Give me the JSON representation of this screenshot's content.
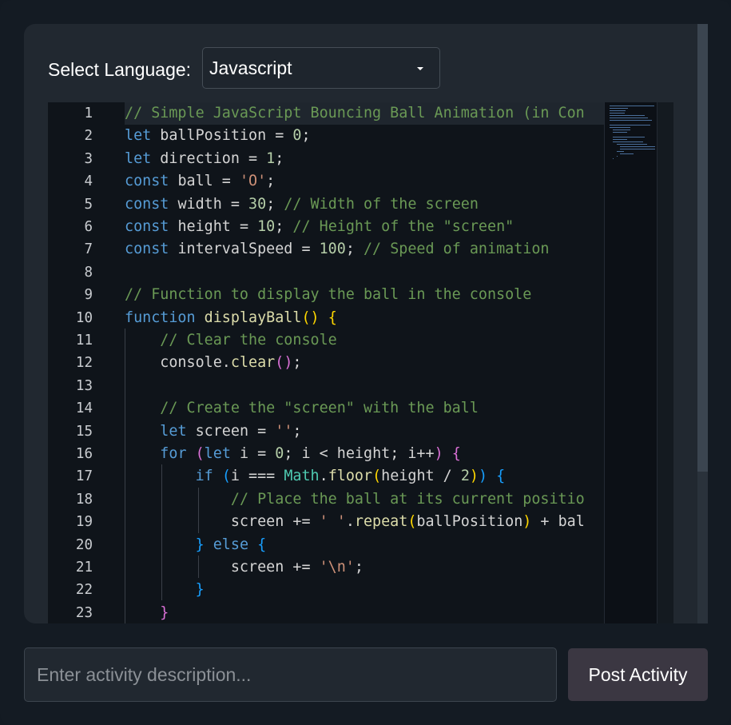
{
  "language": {
    "label": "Select Language:",
    "selected": "Javascript"
  },
  "editor": {
    "line_numbers": [
      "1",
      "2",
      "3",
      "4",
      "5",
      "6",
      "7",
      "8",
      "9",
      "10",
      "11",
      "12",
      "13",
      "14",
      "15",
      "16",
      "17",
      "18",
      "19",
      "20",
      "21",
      "22",
      "23"
    ],
    "current_line": 1,
    "lines": [
      [
        [
          "c",
          "// Simple JavaScript Bouncing Ball Animation (in Con"
        ]
      ],
      [
        [
          "k",
          "let"
        ],
        [
          "v",
          " ballPosition = "
        ],
        [
          "n",
          "0"
        ],
        [
          "v",
          ";"
        ]
      ],
      [
        [
          "k",
          "let"
        ],
        [
          "v",
          " direction = "
        ],
        [
          "n",
          "1"
        ],
        [
          "v",
          ";"
        ]
      ],
      [
        [
          "k",
          "const"
        ],
        [
          "v",
          " ball = "
        ],
        [
          "s",
          "'O'"
        ],
        [
          "v",
          ";"
        ]
      ],
      [
        [
          "k",
          "const"
        ],
        [
          "v",
          " width = "
        ],
        [
          "n",
          "30"
        ],
        [
          "v",
          "; "
        ],
        [
          "c",
          "// Width of the screen"
        ]
      ],
      [
        [
          "k",
          "const"
        ],
        [
          "v",
          " height = "
        ],
        [
          "n",
          "10"
        ],
        [
          "v",
          "; "
        ],
        [
          "c",
          "// Height of the \"screen\""
        ]
      ],
      [
        [
          "k",
          "const"
        ],
        [
          "v",
          " intervalSpeed = "
        ],
        [
          "n",
          "100"
        ],
        [
          "v",
          "; "
        ],
        [
          "c",
          "// Speed of animation"
        ]
      ],
      [],
      [
        [
          "c",
          "// Function to display the ball in the console"
        ]
      ],
      [
        [
          "k",
          "function"
        ],
        [
          "v",
          " "
        ],
        [
          "f",
          "displayBall"
        ],
        [
          "p1",
          "()"
        ],
        [
          "v",
          " "
        ],
        [
          "p1",
          "{"
        ]
      ],
      [
        [
          "v",
          "    "
        ],
        [
          "c",
          "// Clear the console"
        ]
      ],
      [
        [
          "v",
          "    console."
        ],
        [
          "f",
          "clear"
        ],
        [
          "p2",
          "()"
        ],
        [
          "v",
          ";"
        ]
      ],
      [],
      [
        [
          "v",
          "    "
        ],
        [
          "c",
          "// Create the \"screen\" with the ball"
        ]
      ],
      [
        [
          "v",
          "    "
        ],
        [
          "k",
          "let"
        ],
        [
          "v",
          " screen = "
        ],
        [
          "s",
          "''"
        ],
        [
          "v",
          ";"
        ]
      ],
      [
        [
          "v",
          "    "
        ],
        [
          "k",
          "for"
        ],
        [
          "v",
          " "
        ],
        [
          "p2",
          "("
        ],
        [
          "k",
          "let"
        ],
        [
          "v",
          " i = "
        ],
        [
          "n",
          "0"
        ],
        [
          "v",
          "; i < height; i++"
        ],
        [
          "p2",
          ")"
        ],
        [
          "v",
          " "
        ],
        [
          "p2",
          "{"
        ]
      ],
      [
        [
          "v",
          "        "
        ],
        [
          "k",
          "if"
        ],
        [
          "v",
          " "
        ],
        [
          "p3",
          "("
        ],
        [
          "v",
          "i === "
        ],
        [
          "t",
          "Math"
        ],
        [
          "v",
          "."
        ],
        [
          "f",
          "floor"
        ],
        [
          "p1",
          "("
        ],
        [
          "v",
          "height / "
        ],
        [
          "n",
          "2"
        ],
        [
          "p1",
          ")"
        ],
        [
          "p3",
          ")"
        ],
        [
          "v",
          " "
        ],
        [
          "p3",
          "{"
        ]
      ],
      [
        [
          "v",
          "            "
        ],
        [
          "c",
          "// Place the ball at its current positio"
        ]
      ],
      [
        [
          "v",
          "            screen += "
        ],
        [
          "s",
          "' '"
        ],
        [
          "v",
          "."
        ],
        [
          "f",
          "repeat"
        ],
        [
          "p1",
          "("
        ],
        [
          "v",
          "ballPosition"
        ],
        [
          "p1",
          ")"
        ],
        [
          "v",
          " + bal"
        ]
      ],
      [
        [
          "v",
          "        "
        ],
        [
          "p3",
          "}"
        ],
        [
          "v",
          " "
        ],
        [
          "k",
          "else"
        ],
        [
          "v",
          " "
        ],
        [
          "p3",
          "{"
        ]
      ],
      [
        [
          "v",
          "            screen += "
        ],
        [
          "s",
          "'\\n'"
        ],
        [
          "v",
          ";"
        ]
      ],
      [
        [
          "v",
          "        "
        ],
        [
          "p3",
          "}"
        ]
      ],
      [
        [
          "v",
          "    "
        ],
        [
          "p2",
          "}"
        ]
      ]
    ]
  },
  "activity": {
    "placeholder": "Enter activity description...",
    "value": ""
  },
  "post_button": {
    "label": "Post Activity"
  },
  "colors": {
    "background": "#141b23",
    "panel": "#212830",
    "editor": "#0f141a",
    "button": "#3b3742"
  },
  "icons": {
    "select_caret": "caret-down-icon"
  }
}
